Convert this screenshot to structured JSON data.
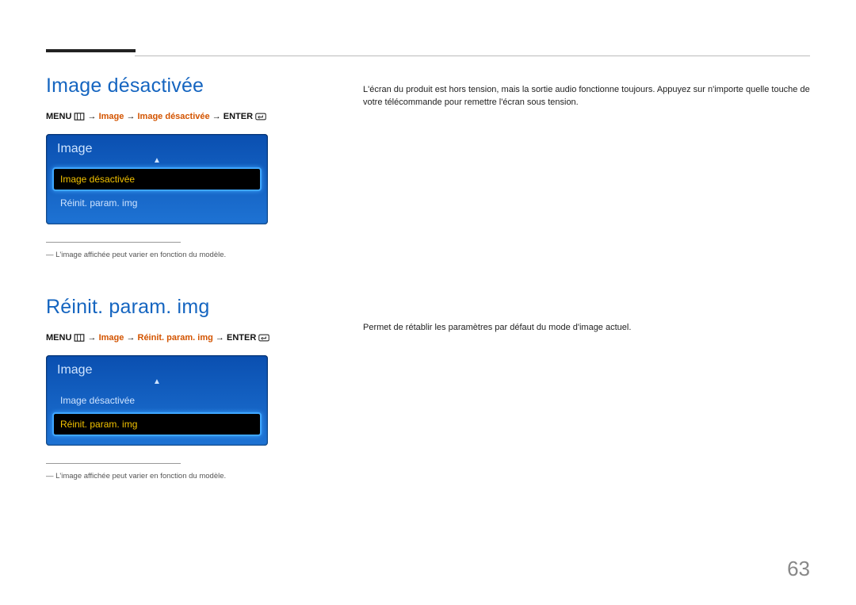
{
  "page_number": "63",
  "section1": {
    "title": "Image désactivée",
    "breadcrumb": {
      "menu": "MENU",
      "arrow": "→",
      "step1": "Image",
      "step2": "Image désactivée",
      "enter": "ENTER"
    },
    "osd": {
      "title": "Image",
      "row_selected": "Image désactivée",
      "row_other": "Réinit. param. img"
    },
    "note": "L'image affichée peut varier en fonction du modèle.",
    "body": "L'écran du produit est hors tension, mais la sortie audio fonctionne toujours. Appuyez sur n'importe quelle touche de votre télécommande pour remettre l'écran sous tension."
  },
  "section2": {
    "title": "Réinit. param. img",
    "breadcrumb": {
      "menu": "MENU",
      "arrow": "→",
      "step1": "Image",
      "step2": "Réinit. param. img",
      "enter": "ENTER"
    },
    "osd": {
      "title": "Image",
      "row_other": "Image désactivée",
      "row_selected": "Réinit. param. img"
    },
    "note": "L'image affichée peut varier en fonction du modèle.",
    "body": "Permet de rétablir les paramètres par défaut du mode d'image actuel."
  }
}
